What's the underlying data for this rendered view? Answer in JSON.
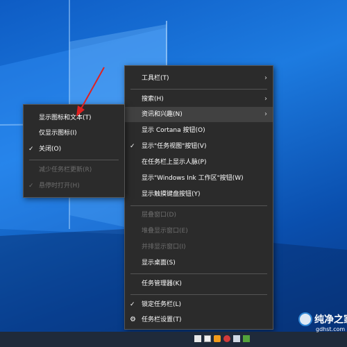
{
  "main_menu": {
    "items": [
      {
        "label": "工具栏(T)"
      },
      {
        "label": "搜索(H)"
      },
      {
        "label": "资讯和兴趣(N)"
      },
      {
        "label": "显示 Cortana 按钮(O)"
      },
      {
        "label": "显示\"任务视图\"按钮(V)"
      },
      {
        "label": "在任务栏上显示人脉(P)"
      },
      {
        "label": "显示\"Windows Ink 工作区\"按钮(W)"
      },
      {
        "label": "显示触摸键盘按钮(Y)"
      },
      {
        "label": "层叠窗口(D)"
      },
      {
        "label": "堆叠显示窗口(E)"
      },
      {
        "label": "并排显示窗口(I)"
      },
      {
        "label": "显示桌面(S)"
      },
      {
        "label": "任务管理器(K)"
      },
      {
        "label": "锁定任务栏(L)"
      },
      {
        "label": "任务栏设置(T)"
      }
    ]
  },
  "sub_menu": {
    "items": [
      {
        "label": "显示图标和文本(T)"
      },
      {
        "label": "仅显示图标(I)"
      },
      {
        "label": "关闭(O)"
      },
      {
        "label": "减少任务栏更新(R)"
      },
      {
        "label": "悬停时打开(H)"
      }
    ]
  },
  "watermark": {
    "title": "纯净之家",
    "url": "gdhst.com"
  },
  "colors": {
    "menu_bg": "#2b2b2b",
    "highlight": "#414141",
    "disabled_text": "#6e6e6e",
    "arrow": "#e02020"
  }
}
